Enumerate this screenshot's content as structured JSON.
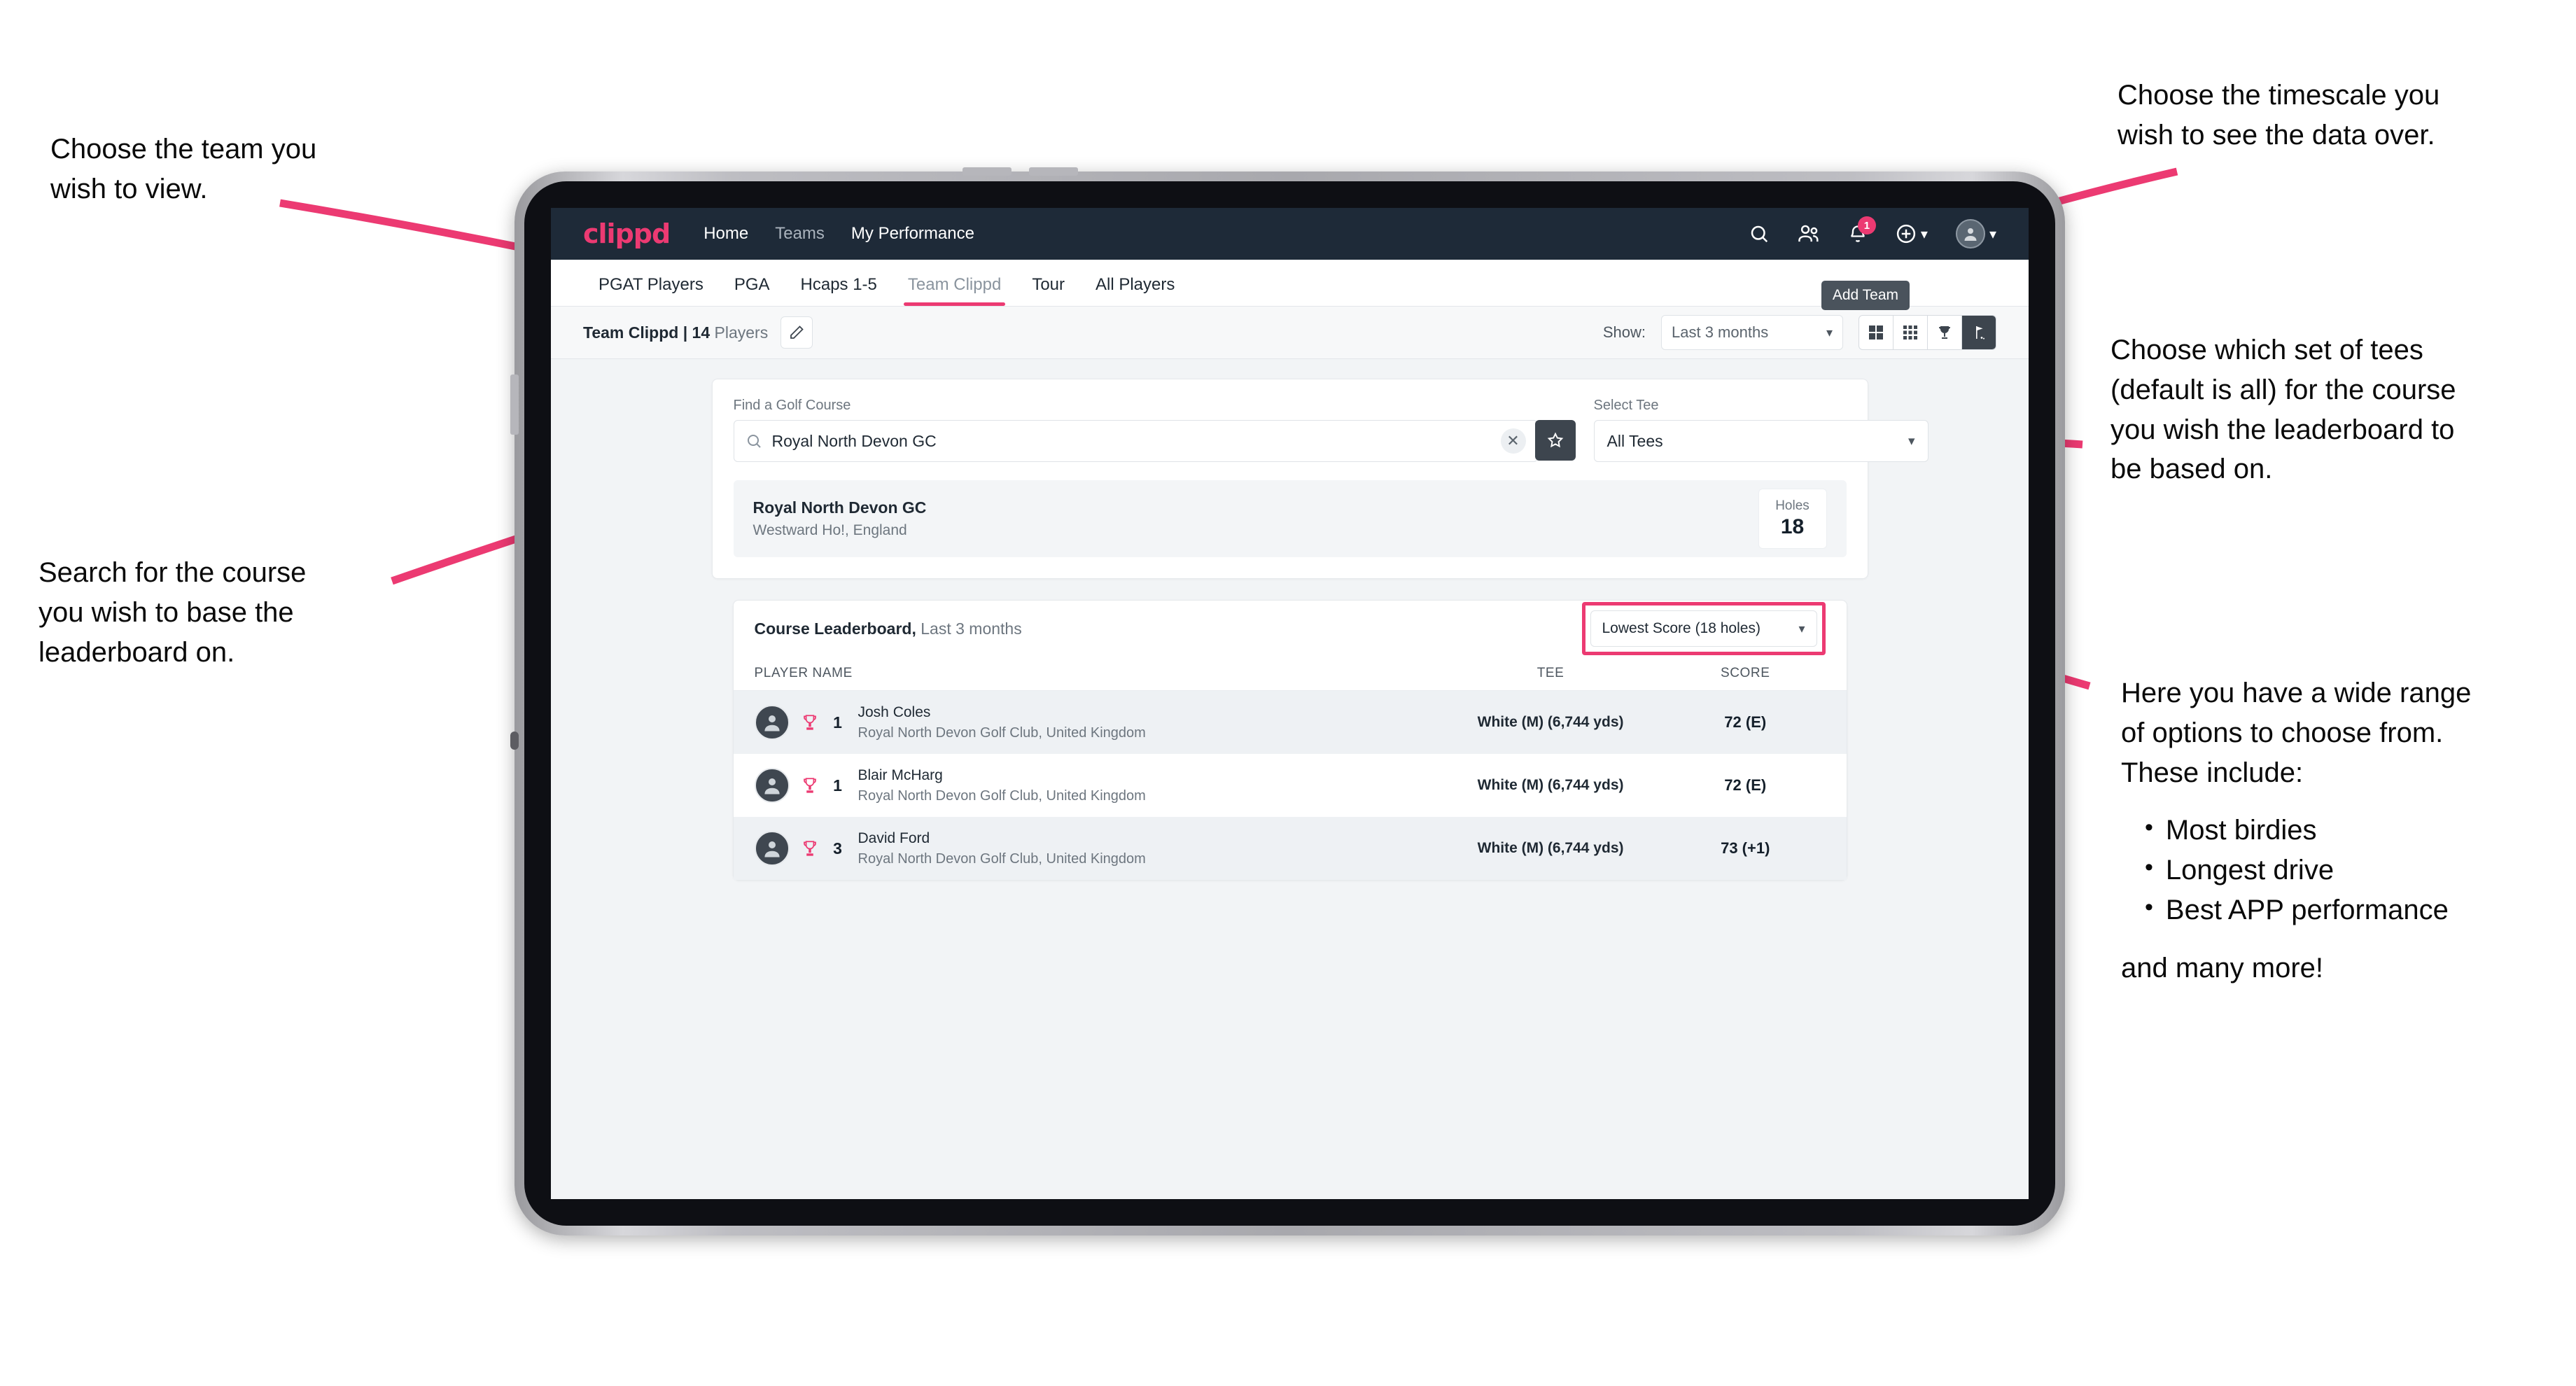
{
  "annotations": {
    "team": "Choose the team you\nwish to view.",
    "timescale": "Choose the timescale you\nwish to see the data over.",
    "tees": "Choose which set of tees\n(default is all) for the course\nyou wish the leaderboard to\nbe based on.",
    "search": "Search for the course\nyou wish to base the\nleaderboard on.",
    "options_intro": "Here you have a wide range\nof options to choose from.\nThese include:",
    "options_list": [
      "Most birdies",
      "Longest drive",
      "Best APP performance"
    ],
    "options_outro": "and many more!"
  },
  "app": {
    "brand": "clippd",
    "nav_links": [
      {
        "label": "Home",
        "dim": false
      },
      {
        "label": "Teams",
        "dim": true
      },
      {
        "label": "My Performance",
        "dim": false
      }
    ],
    "notification_count": "1",
    "icons": {
      "search": "search-icon",
      "people": "people-icon",
      "bell": "bell-icon",
      "plus": "plus-circle-icon",
      "avatar": "avatar-icon"
    }
  },
  "tabs": {
    "items": [
      {
        "label": "PGAT Players",
        "active": false,
        "dim": false
      },
      {
        "label": "PGA",
        "active": false,
        "dim": false
      },
      {
        "label": "Hcaps 1-5",
        "active": false,
        "dim": false
      },
      {
        "label": "Team Clippd",
        "active": true,
        "dim": true
      },
      {
        "label": "Tour",
        "active": false,
        "dim": false
      },
      {
        "label": "All Players",
        "active": false,
        "dim": false
      }
    ],
    "tooltip": "Add Team"
  },
  "toolbar": {
    "team_name": "Team Clippd",
    "separator": " | ",
    "player_count": "14",
    "players_word": " Players",
    "edit_icon": "pencil-icon",
    "show_label": "Show:",
    "timescale_value": "Last 3 months",
    "view_buttons": [
      {
        "name": "grid-2x2-icon",
        "selected": false
      },
      {
        "name": "grid-3x3-icon",
        "selected": false
      },
      {
        "name": "trophy-icon",
        "selected": false
      },
      {
        "name": "flag-icon",
        "selected": true
      }
    ]
  },
  "search": {
    "course_label": "Find a Golf Course",
    "course_value": "Royal North Devon GC",
    "course_placeholder": "Find a Golf Course",
    "clear_icon": "close-icon",
    "star_icon": "star-icon",
    "tee_label": "Select Tee",
    "tee_value": "All Tees"
  },
  "course": {
    "name": "Royal North Devon GC",
    "location": "Westward Ho!, England",
    "holes_label": "Holes",
    "holes_value": "18"
  },
  "leaderboard": {
    "title": "Course Leaderboard,",
    "subtitle": " Last 3 months",
    "sort_value": "Lowest Score (18 holes)",
    "columns": [
      "PLAYER NAME",
      "TEE",
      "SCORE"
    ],
    "rows": [
      {
        "rank": "1",
        "name": "Josh Coles",
        "club": "Royal North Devon Golf Club, United Kingdom",
        "tee": "White (M) (6,744 yds)",
        "score": "72 (E)"
      },
      {
        "rank": "1",
        "name": "Blair McHarg",
        "club": "Royal North Devon Golf Club, United Kingdom",
        "tee": "White (M) (6,744 yds)",
        "score": "72 (E)"
      },
      {
        "rank": "3",
        "name": "David Ford",
        "club": "Royal North Devon Golf Club, United Kingdom",
        "tee": "White (M) (6,744 yds)",
        "score": "73 (+1)"
      }
    ]
  },
  "colors": {
    "accent": "#ec3a72",
    "navbar": "#1e2a38",
    "page_bg": "#f2f4f6",
    "dark_button": "#3d454e"
  }
}
